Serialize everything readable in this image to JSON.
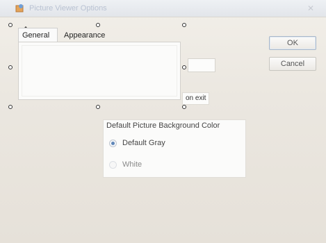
{
  "window": {
    "title": "Picture Viewer Options",
    "close_glyph": "✕"
  },
  "tabs": [
    {
      "label": "General",
      "selected": true
    },
    {
      "label": "Appearance",
      "selected": false
    }
  ],
  "buttons": {
    "ok_label": "OK",
    "cancel_label": "Cancel"
  },
  "partial_label": "on exit",
  "background_group": {
    "title": "Default Picture Background Color",
    "options": [
      {
        "label": "Default Gray",
        "checked": true
      },
      {
        "label": "White",
        "checked": false
      }
    ]
  },
  "colors": {
    "dialog_bg": "#e9e6e0",
    "accent": "#5f86b8"
  },
  "icons": [
    "app-icon",
    "move-icon",
    "close-icon",
    "radio-button-icon"
  ]
}
